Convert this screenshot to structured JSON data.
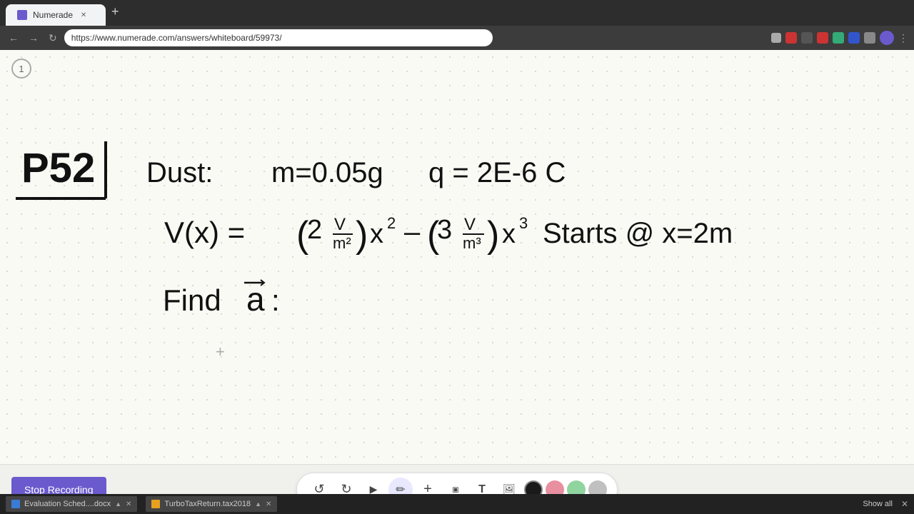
{
  "browser": {
    "tab_label": "Numerade",
    "url": "https://www.numerade.com/answers/whiteboard/59973/",
    "new_tab_symbol": "+"
  },
  "page_number": "1",
  "toolbar": {
    "undo_label": "↺",
    "redo_label": "↻",
    "pointer_label": "▲",
    "pen_label": "✏",
    "add_label": "+",
    "highlighter_label": "/",
    "text_label": "T",
    "image_label": "🖼",
    "colors": [
      "#1a1a1a",
      "#e88fa0",
      "#90d4a0",
      "#c0c0c0"
    ]
  },
  "stop_recording": {
    "label": "Stop Recording"
  },
  "taskbar": {
    "item1_label": "Evaluation Sched....docx",
    "item2_label": "TurboTaxReturn.tax2018",
    "show_all": "Show all"
  },
  "whiteboard_content": {
    "description": "Physics problem P52 with dust particle charge problem handwritten content"
  }
}
